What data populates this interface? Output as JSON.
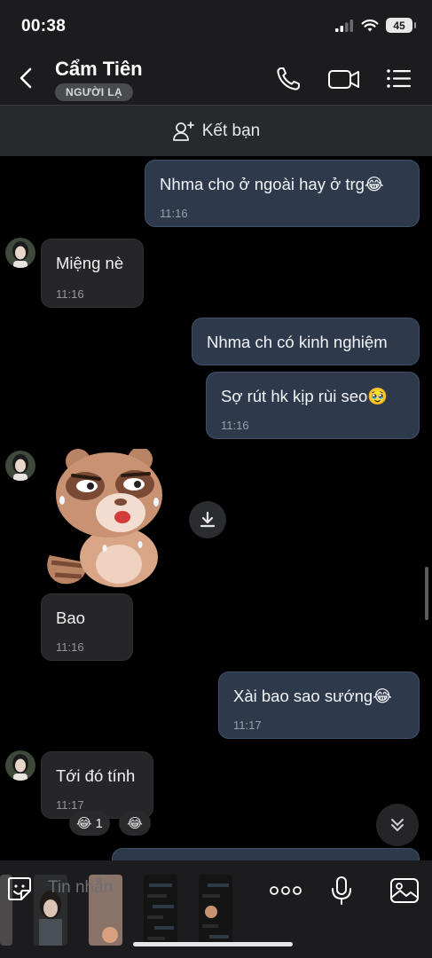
{
  "status_bar": {
    "time": "00:38",
    "battery": "45"
  },
  "header": {
    "contact_name": "Cẩm Tiên",
    "badge": "NGƯỜI LẠ",
    "icons": [
      "back-chevron-icon",
      "phone-icon",
      "video-call-icon",
      "menu-list-icon"
    ]
  },
  "add_friend": {
    "label": "Kết bạn",
    "icon": "add-user-icon"
  },
  "messages": [
    {
      "dir": "out",
      "text": "Nhma cho ở ngoài hay ở trg😂",
      "time": "11:16"
    },
    {
      "dir": "in",
      "text": "Miệng nè",
      "time": "11:16"
    },
    {
      "dir": "out",
      "text": "Nhma ch có kinh nghiệm",
      "time": ""
    },
    {
      "dir": "out",
      "text": "Sợ rút hk kịp rùi seo🥹",
      "time": "11:16"
    },
    {
      "dir": "in",
      "type": "sticker",
      "sticker": "raccoon-sticker"
    },
    {
      "dir": "in",
      "text": "Bao",
      "time": "11:16"
    },
    {
      "dir": "out",
      "text": "Xài bao sao sướng😂",
      "time": "11:17"
    },
    {
      "dir": "in",
      "text": "Tới đó tính",
      "time": "11:17"
    }
  ],
  "reactions": {
    "count": "1",
    "emoji": "😂"
  },
  "composer": {
    "placeholder": "Tin nhắn"
  },
  "colors": {
    "outgoing_bubble": "#2e3a4b",
    "incoming_bubble": "#262628",
    "background": "#000000"
  }
}
